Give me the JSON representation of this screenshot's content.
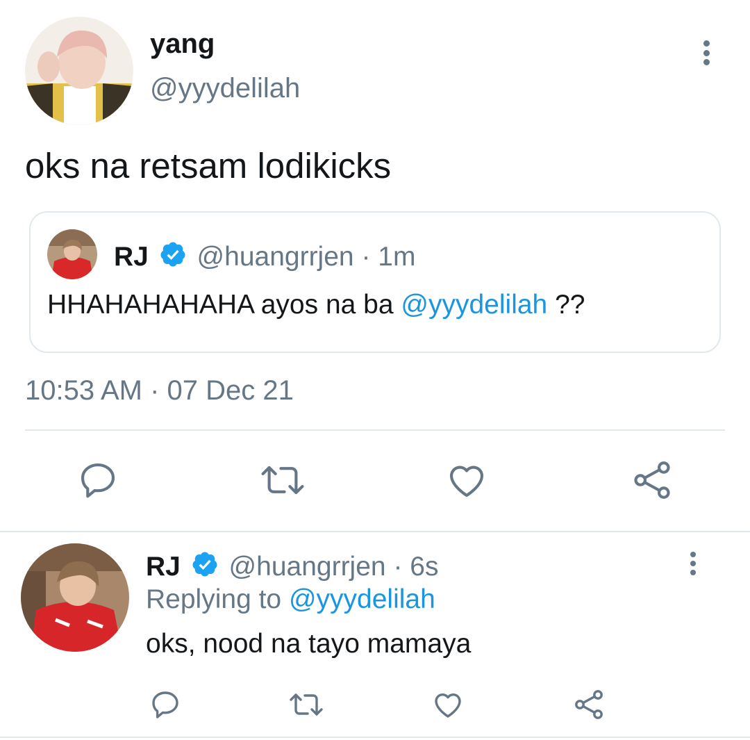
{
  "main_tweet": {
    "author_name": "yang",
    "author_handle": "@yyydelilah",
    "text": "oks na retsam lodikicks",
    "timestamp": "10:53 AM · 07 Dec 21",
    "avatar_icon": "user-avatar"
  },
  "quoted_tweet": {
    "author_name": "RJ",
    "author_handle": "@huangrrjen",
    "age": " · 1m",
    "text_before": "HHAHAHAHAHA ayos na ba ",
    "mention": "@yyydelilah",
    "text_after": " ??",
    "verified": true
  },
  "actions": {
    "icons": [
      "reply-icon",
      "retweet-icon",
      "like-icon",
      "share-icon"
    ]
  },
  "reply_tweet": {
    "author_name": "RJ",
    "author_handle": "@huangrrjen",
    "age": " · 6s",
    "replying_prefix": "Replying to ",
    "replying_to": "@yyydelilah",
    "text": "oks, nood na tayo mamaya",
    "verified": true
  },
  "colors": {
    "accent": "#1b95e0",
    "muted": "#657786",
    "text": "#14171a",
    "divider": "#e1e8ed"
  }
}
